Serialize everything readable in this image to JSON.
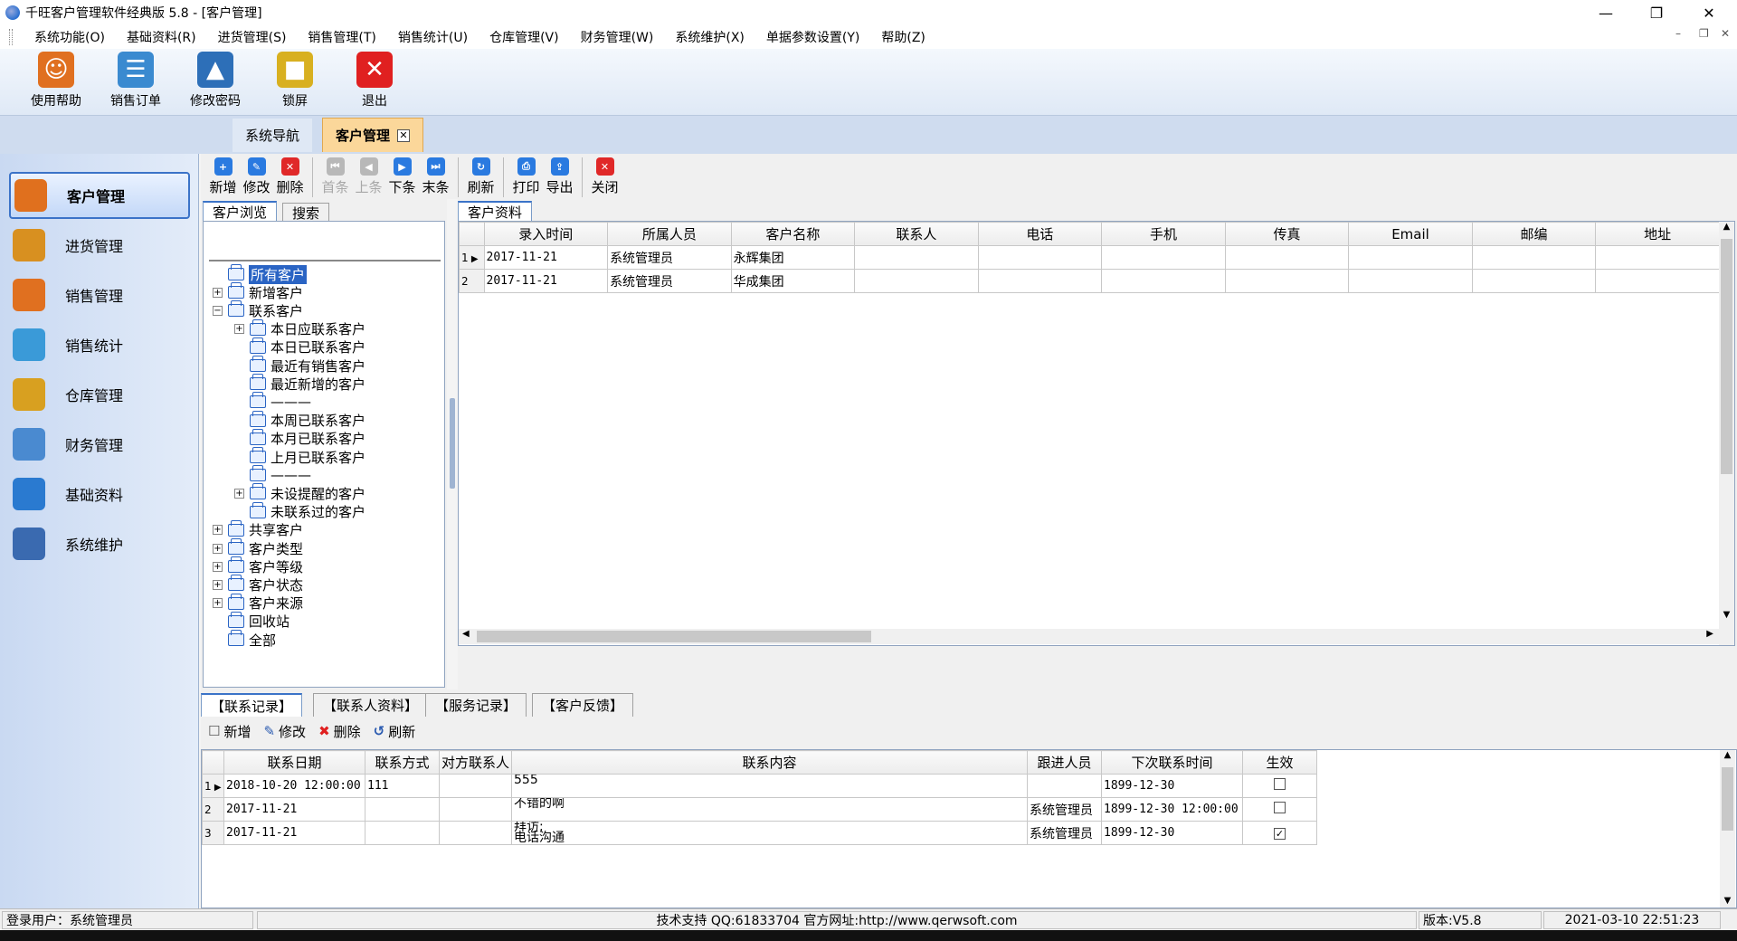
{
  "window": {
    "title": "千旺客户管理软件经典版 5.8 - [客户管理]"
  },
  "menu": [
    "系统功能(O)",
    "基础资料(R)",
    "进货管理(S)",
    "销售管理(T)",
    "销售统计(U)",
    "仓库管理(V)",
    "财务管理(W)",
    "系统维护(X)",
    "单据参数设置(Y)",
    "帮助(Z)"
  ],
  "toolbar": [
    {
      "label": "使用帮助",
      "icon": "help-user-icon",
      "color": "#e07020"
    },
    {
      "label": "销售订单",
      "icon": "sales-order-icon",
      "color": "#3a8ad0"
    },
    {
      "label": "修改密码",
      "icon": "change-password-icon",
      "color": "#2d6fb8"
    },
    {
      "label": "锁屏",
      "icon": "lock-icon",
      "color": "#d8b020"
    },
    {
      "label": "退出",
      "icon": "exit-icon",
      "color": "#e02020"
    }
  ],
  "tabs": [
    {
      "label": "系统导航"
    },
    {
      "label": "客户管理"
    }
  ],
  "nav": [
    {
      "label": "客户管理",
      "icon": "customer-icon"
    },
    {
      "label": "进货管理",
      "icon": "purchase-icon"
    },
    {
      "label": "销售管理",
      "icon": "sales-icon"
    },
    {
      "label": "销售统计",
      "icon": "sales-stats-icon"
    },
    {
      "label": "仓库管理",
      "icon": "warehouse-icon"
    },
    {
      "label": "财务管理",
      "icon": "finance-icon"
    },
    {
      "label": "基础资料",
      "icon": "basic-data-icon"
    },
    {
      "label": "系统维护",
      "icon": "maintenance-icon"
    }
  ],
  "module_toolbar": [
    {
      "label": "新增",
      "icon": "add-icon",
      "enabled": true,
      "color": "#2a7ae0"
    },
    {
      "label": "修改",
      "icon": "edit-icon",
      "enabled": true,
      "color": "#2a7ae0"
    },
    {
      "label": "删除",
      "icon": "delete-icon",
      "enabled": true,
      "color": "#e02828"
    },
    {
      "label": "首条",
      "icon": "first-icon",
      "enabled": false,
      "color": "#b8b8b8"
    },
    {
      "label": "上条",
      "icon": "prev-icon",
      "enabled": false,
      "color": "#b8b8b8"
    },
    {
      "label": "下条",
      "icon": "next-icon",
      "enabled": true,
      "color": "#2a7ae0"
    },
    {
      "label": "末条",
      "icon": "last-icon",
      "enabled": true,
      "color": "#2a7ae0"
    },
    {
      "label": "刷新",
      "icon": "refresh-icon",
      "enabled": true,
      "color": "#2a7ae0"
    },
    {
      "label": "打印",
      "icon": "print-icon",
      "enabled": true,
      "color": "#2a7ae0"
    },
    {
      "label": "导出",
      "icon": "export-icon",
      "enabled": true,
      "color": "#2a7ae0"
    },
    {
      "label": "关闭",
      "icon": "close-icon",
      "enabled": true,
      "color": "#e02828"
    }
  ],
  "left_tabs": [
    "客户浏览",
    "搜索"
  ],
  "tree": [
    {
      "label": "所有客户",
      "level": 0,
      "exp": "",
      "selected": true
    },
    {
      "label": "新增客户",
      "level": 0,
      "exp": "+"
    },
    {
      "label": "联系客户",
      "level": 0,
      "exp": "-"
    },
    {
      "label": "本日应联系客户",
      "level": 1,
      "exp": "+"
    },
    {
      "label": "本日已联系客户",
      "level": 1,
      "exp": ""
    },
    {
      "label": "最近有销售客户",
      "level": 1,
      "exp": ""
    },
    {
      "label": "最近新增的客户",
      "level": 1,
      "exp": ""
    },
    {
      "label": "———",
      "level": 1,
      "exp": ""
    },
    {
      "label": "本周已联系客户",
      "level": 1,
      "exp": ""
    },
    {
      "label": "本月已联系客户",
      "level": 1,
      "exp": ""
    },
    {
      "label": "上月已联系客户",
      "level": 1,
      "exp": ""
    },
    {
      "label": "———",
      "level": 1,
      "exp": ""
    },
    {
      "label": "未设提醒的客户",
      "level": 1,
      "exp": "+"
    },
    {
      "label": "未联系过的客户",
      "level": 1,
      "exp": ""
    },
    {
      "label": "共享客户",
      "level": 0,
      "exp": "+"
    },
    {
      "label": "客户类型",
      "level": 0,
      "exp": "+"
    },
    {
      "label": "客户等级",
      "level": 0,
      "exp": "+"
    },
    {
      "label": "客户状态",
      "level": 0,
      "exp": "+"
    },
    {
      "label": "客户来源",
      "level": 0,
      "exp": "+"
    },
    {
      "label": "回收站",
      "level": 0,
      "exp": ""
    },
    {
      "label": "全部",
      "level": 0,
      "exp": ""
    }
  ],
  "customer_panel": {
    "tab": "客户资料",
    "columns": [
      "录入时间",
      "所属人员",
      "客户名称",
      "联系人",
      "电话",
      "手机",
      "传真",
      "Email",
      "邮编",
      "地址"
    ],
    "rows": [
      {
        "num": "1",
        "cells": [
          "2017-11-21",
          "系统管理员",
          "永辉集团",
          "",
          "",
          "",
          "",
          "",
          "",
          ""
        ]
      },
      {
        "num": "2",
        "cells": [
          "2017-11-21",
          "系统管理员",
          "华成集团",
          "",
          "",
          "",
          "",
          "",
          "",
          ""
        ]
      }
    ]
  },
  "bottom_tabs": [
    "【联系记录】",
    "【联系人资料】",
    "【服务记录】",
    "【客户反馈】"
  ],
  "contact_toolbar": [
    {
      "label": "新增",
      "icon": "new-doc-icon"
    },
    {
      "label": "修改",
      "icon": "pen-icon"
    },
    {
      "label": "删除",
      "icon": "x-delete-icon"
    },
    {
      "label": "刷新",
      "icon": "refresh-arrow-icon"
    }
  ],
  "contact_table": {
    "columns": [
      "联系日期",
      "联系方式",
      "对方联系人",
      "联系内容",
      "跟进人员",
      "下次联系时间",
      "生效"
    ],
    "rows": [
      {
        "num": "1",
        "date": "2018-10-20 12:00:00",
        "method": "111",
        "contact": "",
        "content": "555",
        "follower": "",
        "next": "1899-12-30",
        "active": false
      },
      {
        "num": "2",
        "date": "2017-11-21",
        "method": "",
        "contact": "",
        "content": "不错的啊",
        "follower": "系统管理员",
        "next": "1899-12-30 12:00:00",
        "active": false
      },
      {
        "num": "3",
        "date": "2017-11-21",
        "method": "",
        "contact": "",
        "content": "拜访;\n电话沟通",
        "follower": "系统管理员",
        "next": "1899-12-30",
        "active": true
      }
    ]
  },
  "status": {
    "user": "登录用户：系统管理员",
    "support": "技术支持 QQ:61833704 官方网址:http://www.qerwsoft.com",
    "version": "版本:V5.8",
    "datetime": "2021-03-10 22:51:23"
  }
}
